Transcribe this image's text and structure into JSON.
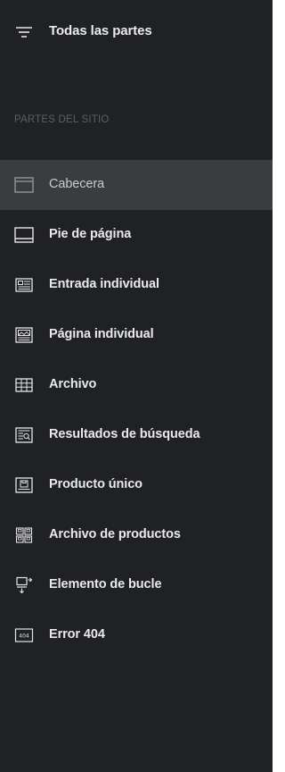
{
  "header": {
    "all_parts_label": "Todas las partes",
    "all_parts_icon": "filter-lines-icon"
  },
  "section": {
    "heading": "PARTES DEL SITIO"
  },
  "menu": {
    "items": [
      {
        "label": "Cabecera",
        "icon": "header-layout-icon",
        "active": true
      },
      {
        "label": "Pie de página",
        "icon": "footer-layout-icon",
        "active": false
      },
      {
        "label": "Entrada individual",
        "icon": "single-post-icon",
        "active": false
      },
      {
        "label": "Página individual",
        "icon": "single-page-icon",
        "active": false
      },
      {
        "label": "Archivo",
        "icon": "archive-grid-icon",
        "active": false
      },
      {
        "label": "Resultados de búsqueda",
        "icon": "search-results-icon",
        "active": false
      },
      {
        "label": "Producto único",
        "icon": "single-product-icon",
        "active": false
      },
      {
        "label": "Archivo de productos",
        "icon": "products-archive-icon",
        "active": false
      },
      {
        "label": "Elemento de bucle",
        "icon": "loop-item-icon",
        "active": false
      },
      {
        "label": "Error 404",
        "icon": "error-404-icon",
        "active": false
      }
    ]
  },
  "colors": {
    "panel_bg": "#1f2124",
    "active_bg": "#3a3c40",
    "text": "#eaeaea",
    "muted": "#5c5f63"
  }
}
